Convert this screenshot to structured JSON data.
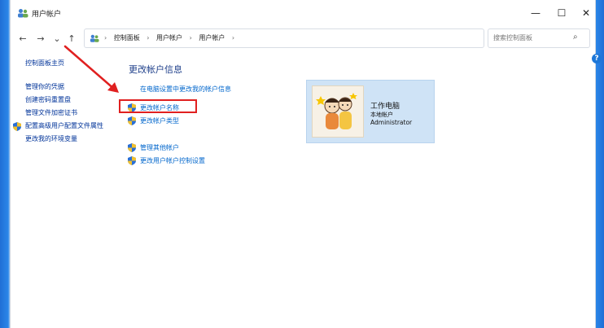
{
  "window": {
    "title": "用户帐户",
    "controls": {
      "minimize": "—",
      "maximize": "☐",
      "close": "✕"
    }
  },
  "nav": {
    "back": "←",
    "forward": "→",
    "recent": "⌄",
    "up": "↑"
  },
  "address": {
    "breadcrumbs": [
      "控制面板",
      "用户帐户",
      "用户帐户"
    ],
    "separator": "›",
    "dropdown": "⌄",
    "refresh": "↻"
  },
  "search": {
    "placeholder": "搜索控制面板",
    "icon": "⌕"
  },
  "help": {
    "label": "?"
  },
  "sidebar": {
    "title": "控制面板主页",
    "items": [
      {
        "label": "管理你的凭据",
        "shield": false
      },
      {
        "label": "创建密码重置盘",
        "shield": false
      },
      {
        "label": "管理文件加密证书",
        "shield": false
      },
      {
        "label": "配置高级用户配置文件属性",
        "shield": true
      },
      {
        "label": "更改我的环境变量",
        "shield": false
      }
    ]
  },
  "main": {
    "title": "更改帐户信息",
    "links": {
      "pc_settings": "在电脑设置中更改我的帐户信息",
      "change_name": "更改帐户名称",
      "change_type": "更改帐户类型",
      "manage_other": "管理其他帐户",
      "uac_settings": "更改用户帐户控制设置"
    }
  },
  "account": {
    "name": "工作电脑",
    "type": "本地帐户",
    "role": "Administrator"
  },
  "colors": {
    "link": "#0066cc",
    "title": "#1e3f8a",
    "highlight": "#e02020",
    "card": "#cfe3f6"
  }
}
